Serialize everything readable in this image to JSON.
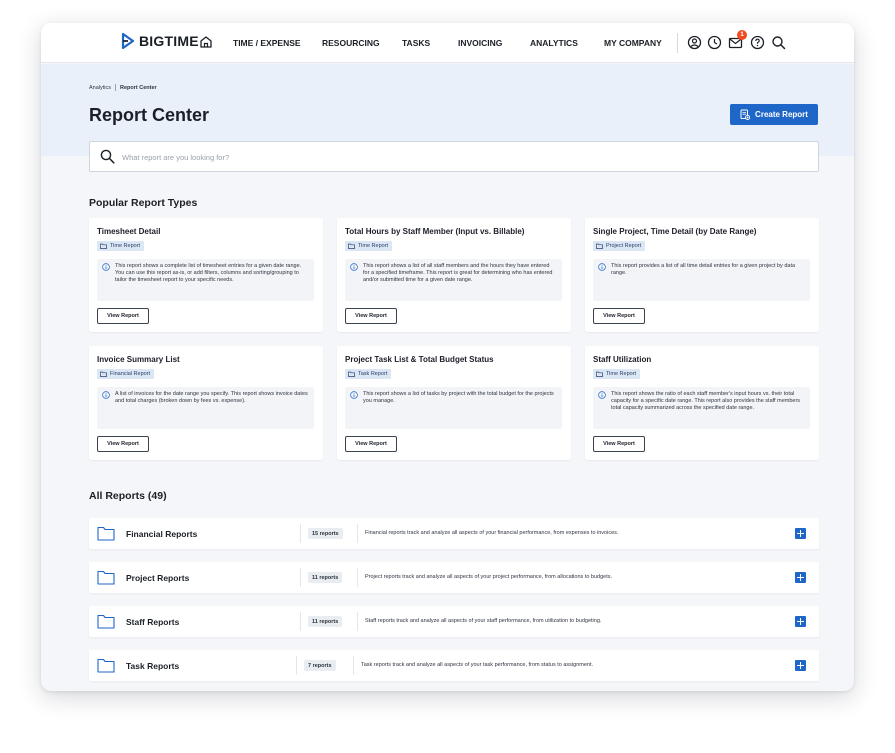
{
  "app": {
    "brand": "BIGTIME"
  },
  "nav": {
    "items": [
      "TIME / EXPENSE",
      "RESOURCING",
      "TASKS",
      "INVOICING",
      "ANALYTICS",
      "MY COMPANY"
    ],
    "icons": [
      "user-circle-icon",
      "clock-icon",
      "mail-icon",
      "help-icon",
      "search-icon"
    ],
    "notification_count": "1"
  },
  "header": {
    "breadcrumb": [
      "Analytics",
      "Report Center"
    ],
    "title": "Report Center",
    "create_button": "Create Report"
  },
  "search": {
    "placeholder": "What report are you looking for?"
  },
  "popular": {
    "title": "Popular Report Types",
    "view_label": "View Report",
    "cards": [
      {
        "title": "Timesheet Detail",
        "tag": "Time Report",
        "description": "This report shows a complete list of timesheet entries for a given date range. You can use this report as-is, or add filters, columns and sorting/grouping to tailor the timesheet report to your specific needs."
      },
      {
        "title": "Total Hours by Staff Member (Input vs. Billable)",
        "tag": "Time Report",
        "description": "This report shows a list of all staff members and the hours they have entered for a specified timeframe. This report is great for determining who has entered and/or submitted time for a given date range."
      },
      {
        "title": "Single Project, Time Detail (by Date Range)",
        "tag": "Project Report",
        "description": "This report provides a list of all time detail entries for a given project by data range."
      },
      {
        "title": "Invoice Summary List",
        "tag": "Financial Report",
        "description": "A list of invoices for the date range you specify. This report shows invoice dates and total charges (broken down by fees vs. expense)."
      },
      {
        "title": "Project Task List & Total Budget Status",
        "tag": "Task Report",
        "description": "This report shows a list of tasks by project with the total budget for the projects you manage."
      },
      {
        "title": "Staff Utilization",
        "tag": "Time Report",
        "description": "This report shows the ratio of each staff member's input hours vs. their total capacity for a specific date range. This report also provides the staff members total capacity summarized across the specified date range."
      }
    ]
  },
  "all_reports": {
    "title": "All Reports (49)",
    "rows": [
      {
        "name": "Financial Reports",
        "count": "15 reports",
        "description": "Financial reports track and analyze all aspects of your financial performance, from expenses to invoices."
      },
      {
        "name": "Project Reports",
        "count": "11 reports",
        "description": "Project reports track and analyze all aspects of your project performance, from allocations to budgets."
      },
      {
        "name": "Staff Reports",
        "count": "11 reports",
        "description": "Staff reports track and analyze all aspects of your staff performance, from utilization to budgeting."
      },
      {
        "name": "Task Reports",
        "count": "7 reports",
        "description": "Task reports track and analyze all aspects of your task performance, from status to assignment."
      }
    ]
  },
  "colors": {
    "accent": "#1f66c9",
    "header_band": "#e9f0fa",
    "badge": "#ef4a1f"
  }
}
